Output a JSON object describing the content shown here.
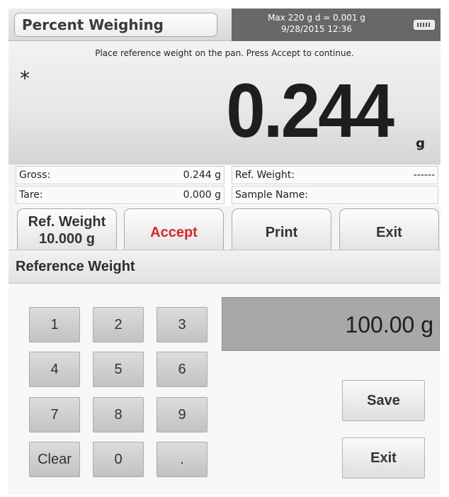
{
  "header": {
    "app_title": "Percent Weighing",
    "capacity": "Max 220 g  d = 0.001 g",
    "datetime": "9/28/2015  12:36",
    "connection_icon": "usb-port-icon"
  },
  "display": {
    "instruction": "Place reference weight on the pan. Press Accept to continue.",
    "stability_indicator": "*",
    "weight": "0.244",
    "unit": "g"
  },
  "info": {
    "gross_label": "Gross:",
    "gross_value": "0.244 g",
    "tare_label": "Tare:",
    "tare_value": "0.000 g",
    "ref_weight_label": "Ref. Weight:",
    "ref_weight_value": "------",
    "sample_name_label": "Sample Name:",
    "sample_name_value": ""
  },
  "buttons": {
    "ref_weight_line1": "Ref. Weight",
    "ref_weight_line2": "10.000 g",
    "accept": "Accept",
    "print": "Print",
    "exit": "Exit"
  },
  "dialog": {
    "title": "Reference Weight",
    "entry_value": "100.00 g",
    "keys": [
      "1",
      "2",
      "3",
      "4",
      "5",
      "6",
      "7",
      "8",
      "9",
      "Clear",
      "0",
      "."
    ],
    "save": "Save",
    "exit": "Exit"
  },
  "colors": {
    "accept_text": "#d62828",
    "info_bar": "#686868",
    "entry_display": "#a8a8a8"
  }
}
